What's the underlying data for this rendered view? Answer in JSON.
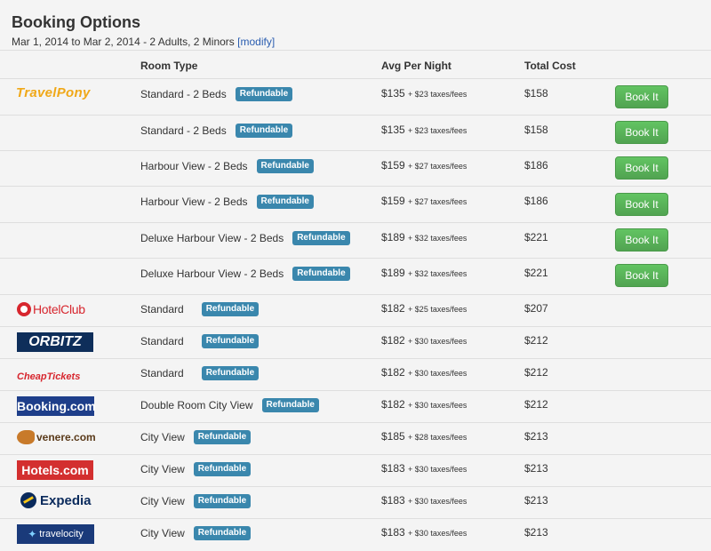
{
  "title": "Booking Options",
  "subtitle": "Mar 1, 2014 to Mar 2, 2014 - 2 Adults, 2 Minors",
  "modify_link": "[modify]",
  "columns": {
    "room_type": "Room Type",
    "avg": "Avg Per Night",
    "total": "Total Cost"
  },
  "badge_label": "Refundable",
  "book_label": "Book It",
  "providers": [
    {
      "logo_text": "TravelPony",
      "options": [
        {
          "room": "Standard - 2 Beds",
          "avg": "$135",
          "taxes": "+ $23 taxes/fees",
          "total": "$158"
        },
        {
          "room": "Standard - 2 Beds",
          "avg": "$135",
          "taxes": "+ $23 taxes/fees",
          "total": "$158"
        },
        {
          "room": "Harbour View - 2 Beds",
          "avg": "$159",
          "taxes": "+ $27 taxes/fees",
          "total": "$186"
        },
        {
          "room": "Harbour View - 2 Beds",
          "avg": "$159",
          "taxes": "+ $27 taxes/fees",
          "total": "$186"
        },
        {
          "room": "Deluxe Harbour View - 2 Beds",
          "avg": "$189",
          "taxes": "+ $32 taxes/fees",
          "total": "$221"
        },
        {
          "room": "Deluxe Harbour View - 2 Beds",
          "avg": "$189",
          "taxes": "+ $32 taxes/fees",
          "total": "$221"
        }
      ]
    },
    {
      "logo_text": "HotelClub",
      "room": "Standard",
      "avg": "$182",
      "taxes": "+ $25 taxes/fees",
      "total": "$207"
    },
    {
      "logo_text": "ORBITZ",
      "room": "Standard",
      "avg": "$182",
      "taxes": "+ $30 taxes/fees",
      "total": "$212"
    },
    {
      "logo_text": "CheapTickets",
      "room": "Standard",
      "avg": "$182",
      "taxes": "+ $30 taxes/fees",
      "total": "$212"
    },
    {
      "logo_text": "Booking.com",
      "room": "Double Room City View",
      "avg": "$182",
      "taxes": "+ $30 taxes/fees",
      "total": "$212"
    },
    {
      "logo_text": "venere.com",
      "room": "City View",
      "avg": "$185",
      "taxes": "+ $28 taxes/fees",
      "total": "$213"
    },
    {
      "logo_text": "Hotels.com",
      "room": "City View",
      "avg": "$183",
      "taxes": "+ $30 taxes/fees",
      "total": "$213"
    },
    {
      "logo_text": "Expedia",
      "room": "City View",
      "avg": "$183",
      "taxes": "+ $30 taxes/fees",
      "total": "$213"
    },
    {
      "logo_text": "travelocity",
      "room": "City View",
      "avg": "$183",
      "taxes": "+ $30 taxes/fees",
      "total": "$213"
    }
  ],
  "colors": {
    "badge": "#3a87ad",
    "book_button": "#5bb75b",
    "link": "#2a5db0",
    "travelpony": "#f0a818",
    "hotelclub": "#d7262e",
    "orbitz": "#0e2e5a",
    "booking": "#1e3e8a",
    "hotels": "#d32f2f",
    "expedia": "#0a2a5c",
    "travelocity": "#1a3a7a"
  }
}
